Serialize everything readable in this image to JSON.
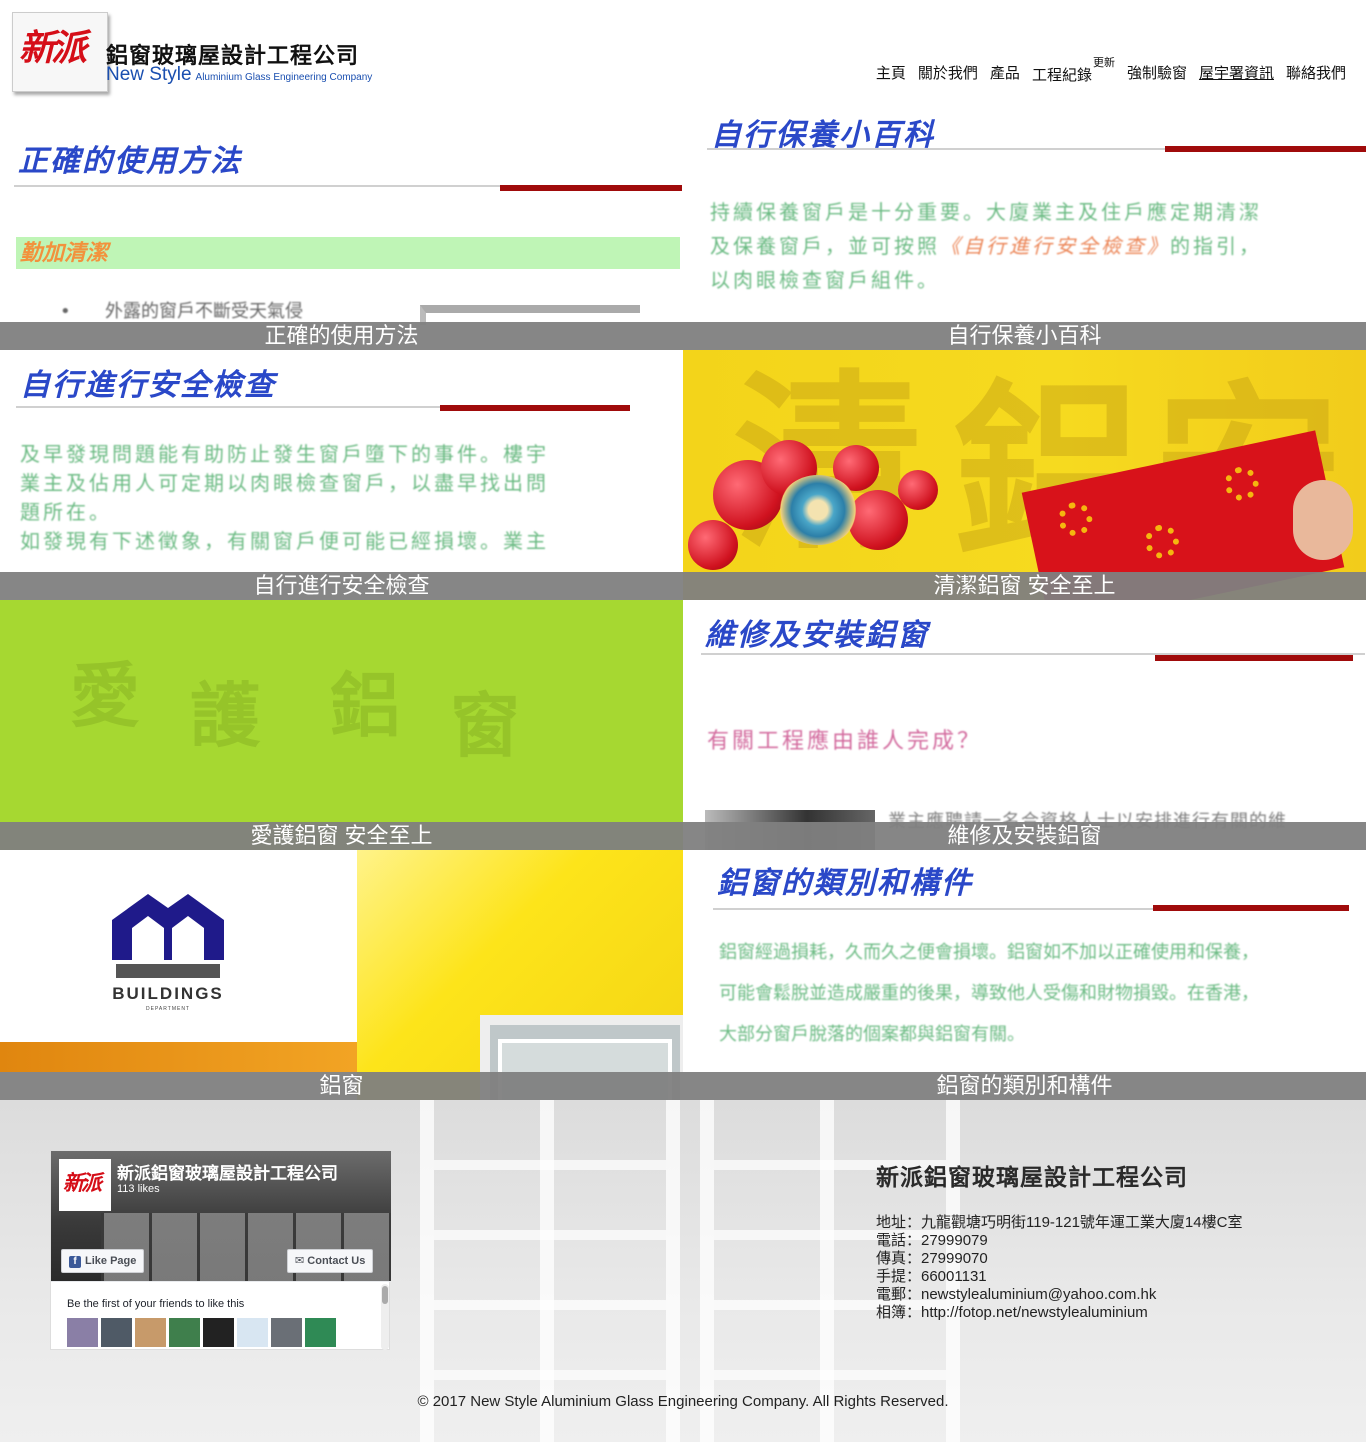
{
  "brand": {
    "logo_mark": "新派",
    "name_cn": "鋁窗玻璃屋設計工程公司",
    "name_en_main": "New Style",
    "name_en_sub": "Aluminium Glass Engineering Company",
    "logo_color": "#d50e18",
    "en_color": "#1a4fb0"
  },
  "nav": {
    "items": [
      {
        "label": "主頁"
      },
      {
        "label": "關於我們"
      },
      {
        "label": "產品"
      },
      {
        "label": "工程紀錄",
        "badge": "更新"
      },
      {
        "label": "強制驗窗"
      },
      {
        "label": "屋宇署資訊"
      },
      {
        "label": "聯絡我們"
      }
    ]
  },
  "tiles": [
    {
      "caption": "正確的使用方法",
      "doc_title": "正確的使用方法",
      "band_label": "勤加清潔",
      "bullet": "外露的窗戶不斷受天氣侵"
    },
    {
      "caption": "自行保養小百科",
      "doc_title": "自行保養小百科",
      "body_lines": [
        "持續保養窗戶是十分重要。大廈業主及住戶應定期清潔",
        "及保養窗戶，並可按照",
        "的指引，",
        "以肉眼檢查窗戶組件。"
      ],
      "body_link": "《自行進行安全檢查》"
    },
    {
      "caption": "自行進行安全檢查",
      "doc_title": "自行進行安全檢查",
      "body_lines": [
        "及早發現問題能有助防止發生窗戶墮下的事件。樓宇",
        "業主及佔用人可定期以肉眼檢查窗戶，以盡早找出問",
        "題所在。",
        "如發現有下述徵象，有關窗戶便可能已經損壞。業主"
      ]
    },
    {
      "caption": "清潔鋁窗 安全至上",
      "art_chars": [
        "清",
        "鋁",
        "安"
      ]
    },
    {
      "caption": "愛護鋁窗 安全至上",
      "art_chars": [
        "愛",
        "護",
        "鋁",
        "窗"
      ]
    },
    {
      "caption": "維修及安裝鋁窗",
      "doc_title": "維修及安裝鋁窗",
      "question": "有關工程應由誰人完成？",
      "snippet": "業主應聘請一名合資格人士以安排進行有關的維"
    },
    {
      "caption": "鋁窗",
      "bd_word": "BUILDINGS",
      "bd_sub": "DEPARTMENT"
    },
    {
      "caption": "鋁窗的類別和構件",
      "doc_title": "鋁窗的類別和構件",
      "body_lines": [
        "鋁窗經過損耗，久而久之便會損壞。鋁窗如不加以正確使用和保養，",
        "可能會鬆脫並造成嚴重的後果，導致他人受傷和財物損毀。在香港，",
        "大部分窗戶脫落的個案都與鋁窗有關。"
      ]
    }
  ],
  "facebook": {
    "page_name": "新派鋁窗玻璃屋設計工程公司",
    "likes": "113 likes",
    "like_button": "Like Page",
    "contact_button": "Contact Us",
    "friends_text": "Be the first of your friends to like this",
    "thumb_colors": [
      "#8a7fa6",
      "#4f5a66",
      "#c79a6a",
      "#3f7f4c",
      "#222222",
      "#d8e6f2",
      "#6a6f76",
      "#2f8a55"
    ]
  },
  "company": {
    "name": "新派鋁窗玻璃屋設計工程公司",
    "lines": [
      "地址：九龍觀塘巧明街119-121號年運工業大廈14樓C室",
      "電話：27999079",
      "傳真：27999070",
      "手提：66001131",
      "電郵：newstylealuminium@yahoo.com.hk",
      "相簿：http://fotop.net/newstylealuminium"
    ]
  },
  "copyright": "© 2017 New Style Aluminium Glass Engineering Company. All Rights Reserved.",
  "colors": {
    "caption_bg": "#808080",
    "doc_title": "#2a48c8",
    "rule_red": "#a00b0b"
  }
}
